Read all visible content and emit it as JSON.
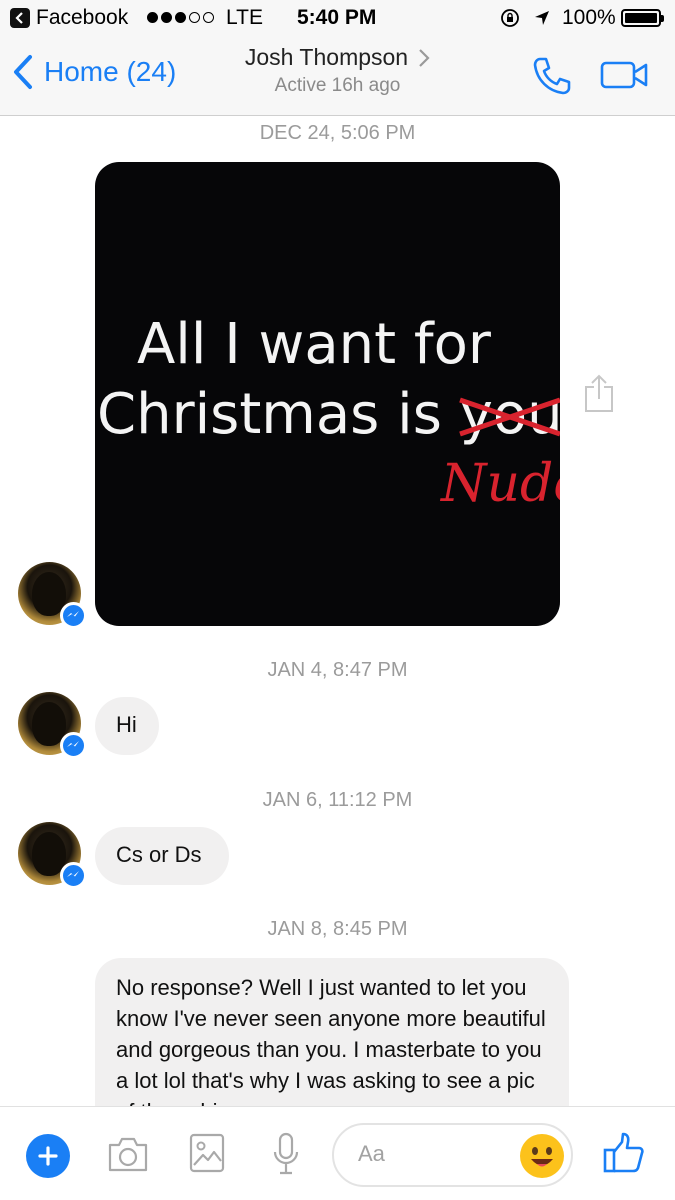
{
  "status_bar": {
    "app": "Facebook",
    "carrier": "LTE",
    "time": "5:40 PM",
    "battery": "100%",
    "signal_bars_filled": 3,
    "signal_bars_total": 5
  },
  "header": {
    "back_label": "Home (24)",
    "contact_name": "Josh Thompson",
    "status": "Active 16h ago",
    "accent_color": "#1a7ff5"
  },
  "messages": [
    {
      "timestamp": "DEC 24, 5:06 PM",
      "type": "image",
      "image_text_line1": "All I want for",
      "image_text_line2": "Christmas is ",
      "image_struck_word": "you",
      "image_red_word": "Nudes"
    },
    {
      "timestamp": "JAN 4, 8:47 PM",
      "type": "text",
      "text": "Hi"
    },
    {
      "timestamp": "JAN 6, 11:12 PM",
      "type": "text",
      "text": "Cs or Ds"
    },
    {
      "timestamp": "JAN 8, 8:45 PM",
      "type": "text",
      "text": "No response? Well I just wanted to let you know I've never seen anyone more beautiful and gorgeous than you. I masterbate to you a lot lol that's why I was asking to see a pic of those big"
    }
  ],
  "composer": {
    "placeholder": "Aa",
    "icons": [
      "plus-icon",
      "camera-icon",
      "photo-icon",
      "mic-icon",
      "emoji-icon",
      "like-icon"
    ]
  }
}
